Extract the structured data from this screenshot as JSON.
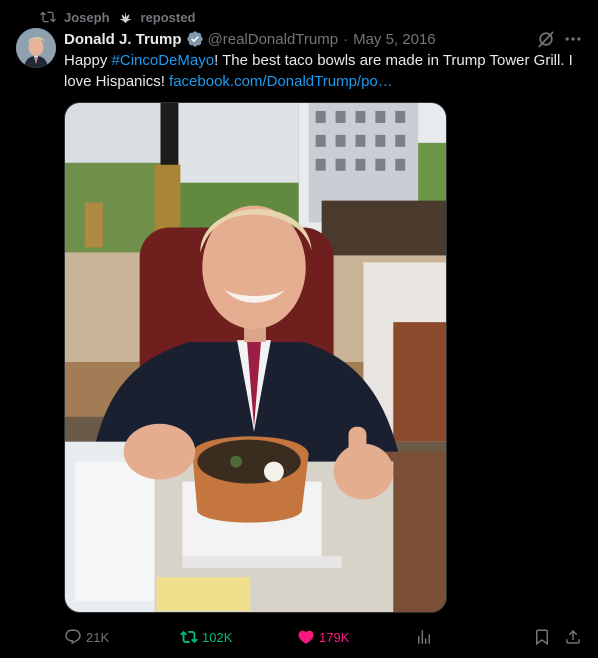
{
  "repost_line": {
    "user": "Joseph",
    "label": "reposted"
  },
  "tweet": {
    "author_name": "Donald J. Trump",
    "handle": "@realDonaldTrump",
    "separator": "·",
    "date": "May 5, 2016",
    "text_before": "Happy ",
    "hashtag": "#CincoDeMayo",
    "text_after": "! The best taco bowls are made in Trump Tower Grill. I love Hispanics! ",
    "link": "facebook.com/DonaldTrump/po…"
  },
  "actions": {
    "replies": "21K",
    "reposts": "102K",
    "likes": "179K"
  },
  "colors": {
    "background": "#000000",
    "text": "#e7e9ea",
    "muted": "#71767b",
    "link": "#1d9bf0",
    "verified": "#829aab",
    "repost_active": "#00ba7c",
    "like_active": "#f91880"
  },
  "icons": {
    "repost": "repost-icon",
    "verified": "verified-badge-icon",
    "grok": "grok-icon",
    "more": "more-icon",
    "reply": "reply-icon",
    "like": "heart-icon",
    "views": "views-icon",
    "bookmark": "bookmark-icon",
    "share": "share-icon"
  }
}
